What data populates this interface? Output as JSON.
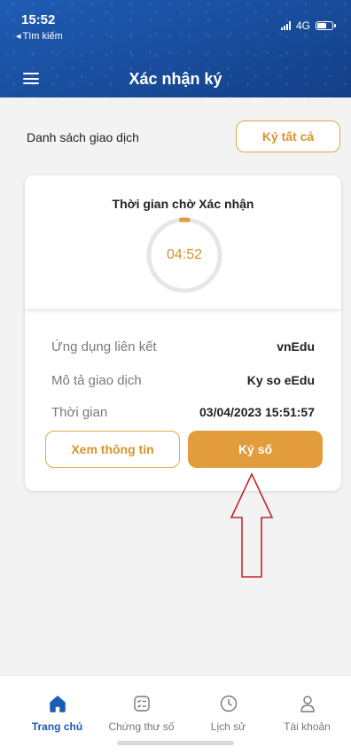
{
  "status_bar": {
    "time": "15:52",
    "back_label": "Tìm kiếm",
    "network": "4G"
  },
  "header": {
    "title": "Xác nhận ký",
    "menu_icon": "hamburger-menu-icon"
  },
  "list": {
    "title": "Danh sách giao dịch",
    "sign_all_label": "Ký tất cả"
  },
  "transaction": {
    "timer_title": "Thời gian chờ Xác nhận",
    "countdown": "04:52",
    "countdown_progress": 0.03,
    "linked_app_label": "Ứng dụng liên kết",
    "linked_app_value": "vnEdu",
    "description_label": "Mô tả giao dịch",
    "description_value": "Ky so eEdu",
    "time_label": "Thời gian",
    "time_value": "03/04/2023 15:51:57",
    "view_info_label": "Xem thông tin",
    "sign_label": "Ký số"
  },
  "bottom_nav": {
    "items": [
      {
        "label": "Trang chủ",
        "icon": "home-icon",
        "active": true
      },
      {
        "label": "Chứng thư số",
        "icon": "certificate-icon",
        "active": false
      },
      {
        "label": "Lịch sử",
        "icon": "clock-icon",
        "active": false
      },
      {
        "label": "Tài khoản",
        "icon": "user-icon",
        "active": false
      }
    ]
  },
  "colors": {
    "header_blue": "#1a4fa0",
    "accent_orange": "#e29c3c",
    "annotation_red": "#c0282d",
    "nav_active": "#1d5cb4"
  }
}
